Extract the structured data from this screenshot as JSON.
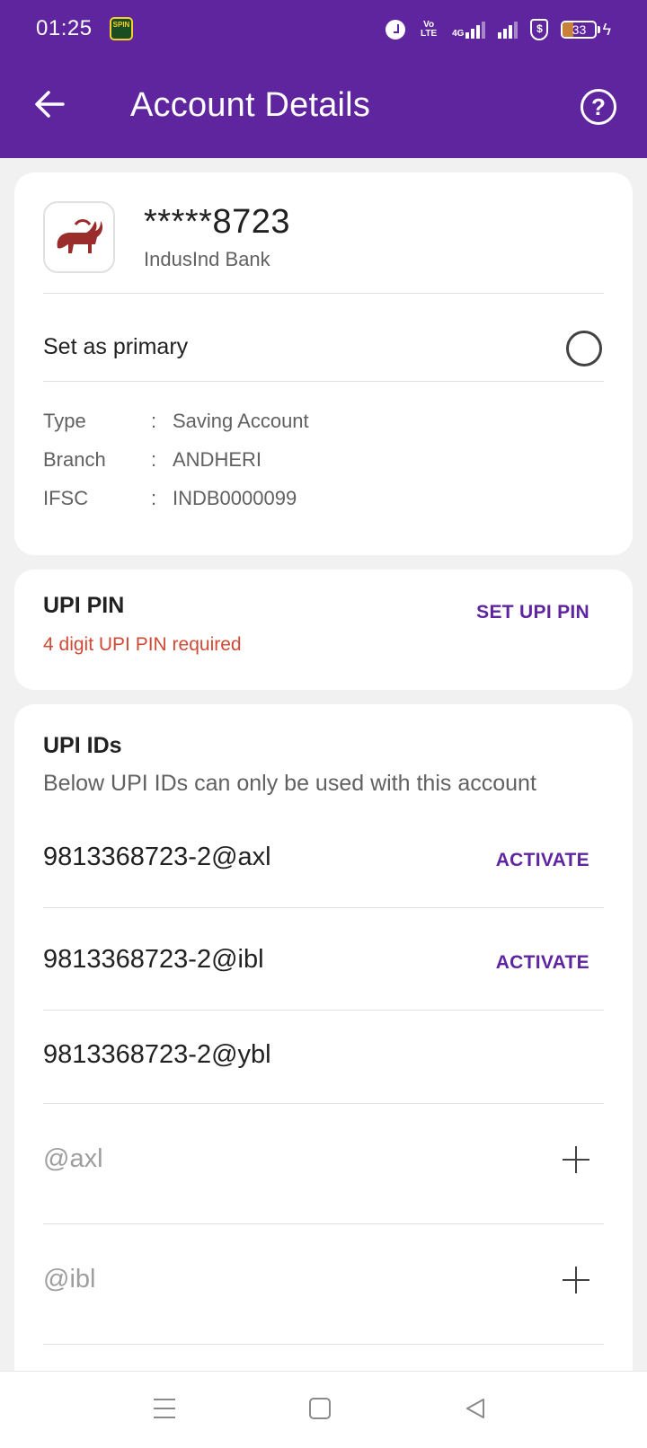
{
  "status_bar": {
    "time": "01:25",
    "spin_badge": "SPIN",
    "volte_label": "Vo LTE",
    "network": "4G",
    "battery": "33"
  },
  "header": {
    "title": "Account Details",
    "back_icon": "arrow-left-icon",
    "help_icon": "help-circle-icon",
    "help_glyph": "?"
  },
  "account": {
    "number": "*****8723",
    "bank": "IndusInd Bank",
    "primary_label": "Set as primary",
    "details": [
      {
        "key": "Type",
        "value": "Saving Account"
      },
      {
        "key": "Branch",
        "value": "ANDHERI"
      },
      {
        "key": "IFSC",
        "value": "INDB0000099"
      }
    ]
  },
  "upi_pin": {
    "title": "UPI PIN",
    "subtitle": "4 digit UPI PIN required",
    "action": "SET UPI PIN"
  },
  "upi_ids": {
    "title": "UPI IDs",
    "subtitle": "Below UPI IDs can only be used with this account",
    "items": [
      {
        "id": "9813368723-2@axl",
        "action": "ACTIVATE"
      },
      {
        "id": "9813368723-2@ibl",
        "action": "ACTIVATE"
      },
      {
        "id": "9813368723-2@ybl",
        "action": ""
      }
    ],
    "add_items": [
      {
        "handle": "@axl"
      },
      {
        "handle": "@ibl"
      }
    ]
  },
  "colors": {
    "brand": "#5f259f",
    "warning": "#d04a36",
    "background": "#f1f1f1"
  }
}
